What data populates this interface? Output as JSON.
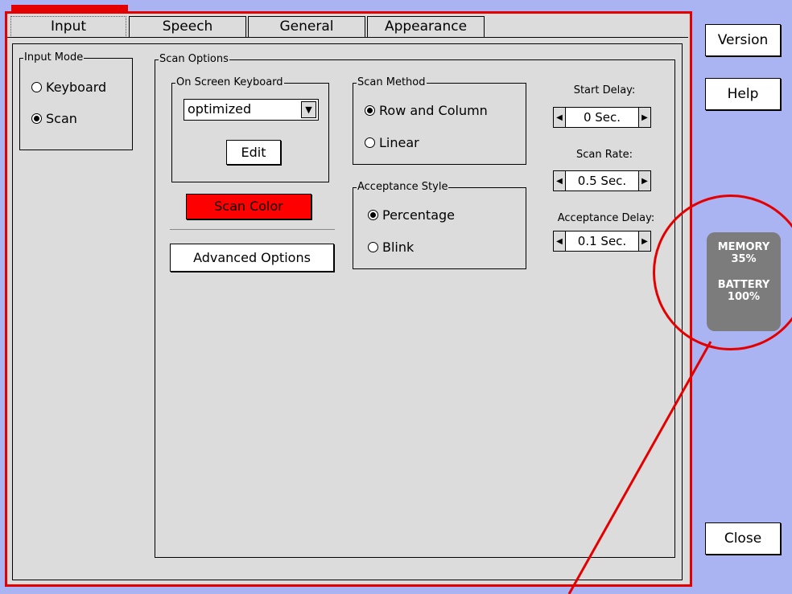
{
  "tabs": [
    {
      "label": "Input",
      "active": true
    },
    {
      "label": "Speech",
      "active": false
    },
    {
      "label": "General",
      "active": false
    },
    {
      "label": "Appearance",
      "active": false
    }
  ],
  "input_mode": {
    "title": "Input Mode",
    "options": [
      {
        "label": "Keyboard",
        "selected": false
      },
      {
        "label": "Scan",
        "selected": true
      }
    ]
  },
  "scan_options": {
    "title": "Scan Options",
    "onscreen_keyboard": {
      "title": "On Screen Keyboard",
      "selected": "optimized",
      "edit_label": "Edit"
    },
    "scan_color_label": "Scan Color",
    "scan_color": "#ff0000",
    "advanced_label": "Advanced Options",
    "scan_method": {
      "title": "Scan Method",
      "options": [
        {
          "label": "Row and Column",
          "selected": true
        },
        {
          "label": "Linear",
          "selected": false
        }
      ]
    },
    "acceptance_style": {
      "title": "Acceptance Style",
      "options": [
        {
          "label": "Percentage",
          "selected": true
        },
        {
          "label": "Blink",
          "selected": false
        }
      ]
    },
    "start_delay": {
      "label": "Start Delay:",
      "value": "0 Sec."
    },
    "scan_rate": {
      "label": "Scan Rate:",
      "value": "0.5 Sec."
    },
    "acceptance_delay": {
      "label": "Acceptance Delay:",
      "value": "0.1 Sec."
    }
  },
  "side": {
    "version_label": "Version",
    "help_label": "Help",
    "close_label": "Close"
  },
  "status": {
    "memory_label": "MEMORY",
    "memory_value": "35%",
    "battery_label": "BATTERY",
    "battery_value": "100%"
  },
  "colors": {
    "highlight": "#e40000",
    "background": "#aab4f2",
    "panel": "#dcdcdc",
    "status_bg": "#7c7c7c"
  }
}
